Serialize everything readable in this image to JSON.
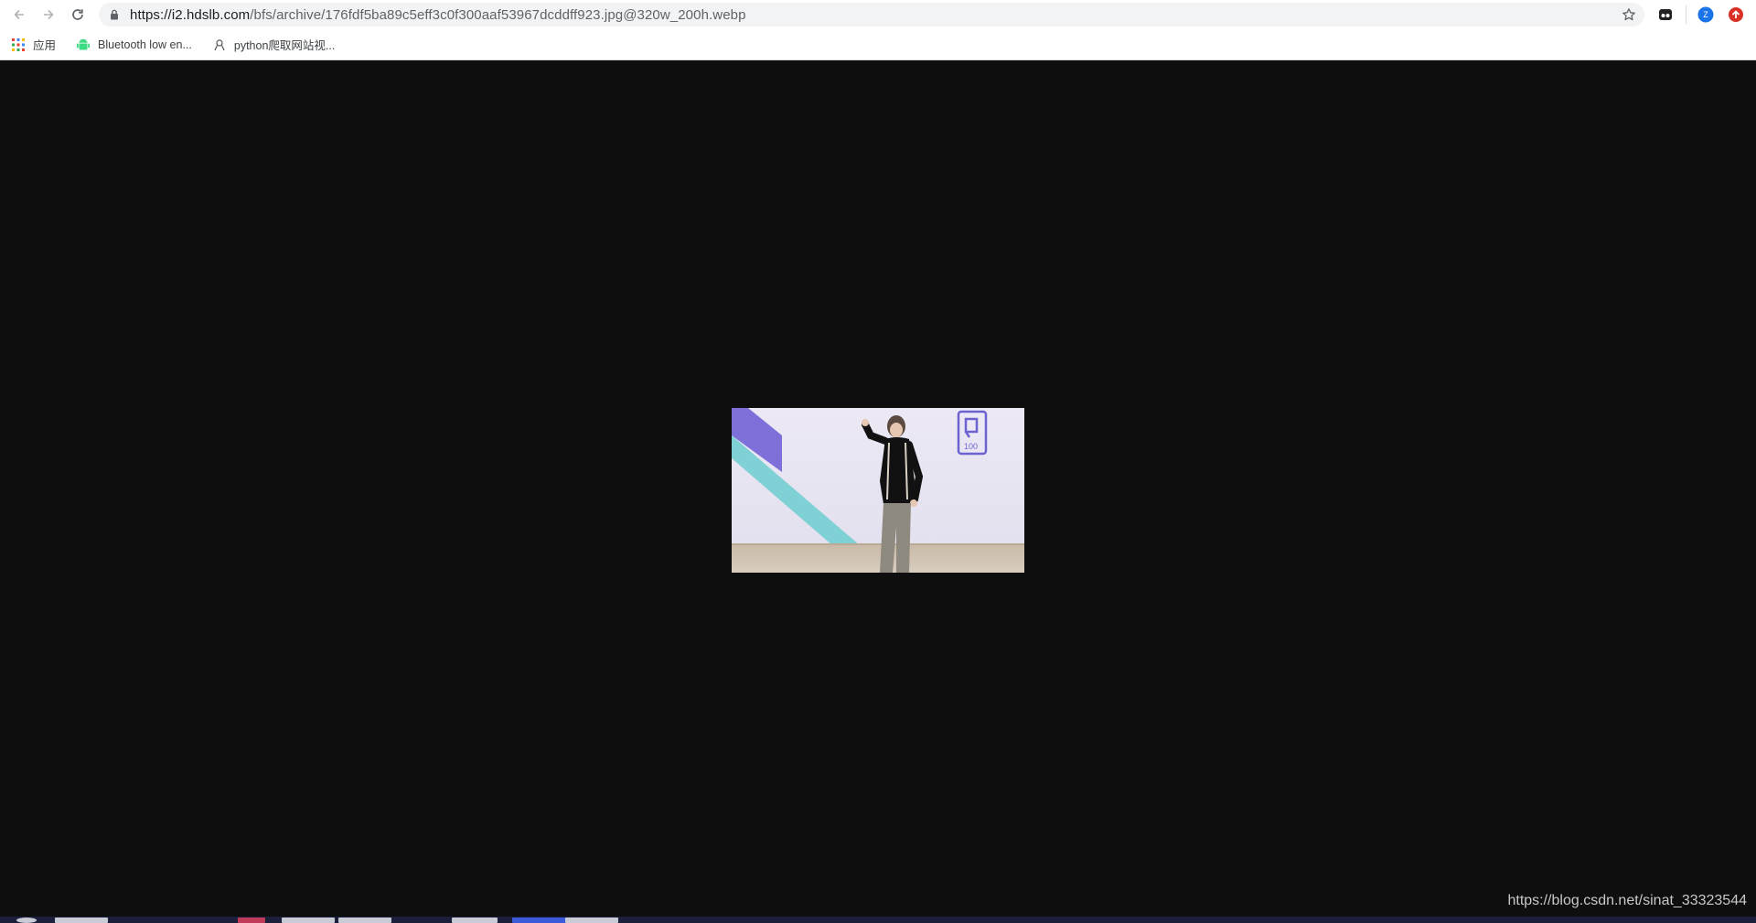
{
  "browser": {
    "url_host": "https://i2.hdslb.com",
    "url_path": "/bfs/archive/176fdf5ba89c5eff3c0f300aaf53967dcddff923.jpg@320w_200h.webp",
    "profile_initial": "Z"
  },
  "bookmarks": [
    {
      "label": "应用",
      "icon": "apps-grid-icon"
    },
    {
      "label": "Bluetooth low en...",
      "icon": "android-icon"
    },
    {
      "label": "python爬取网站视...",
      "icon": "page-icon"
    }
  ],
  "image": {
    "description_hidden": "",
    "logo_text": "100"
  },
  "watermark": "https://blog.csdn.net/sinat_33323544",
  "colors": {
    "viewer_bg": "#0e0e0e",
    "omnibox_bg": "#f1f3f4",
    "profile_blue": "#1a73e8",
    "ext_red": "#d93025"
  }
}
